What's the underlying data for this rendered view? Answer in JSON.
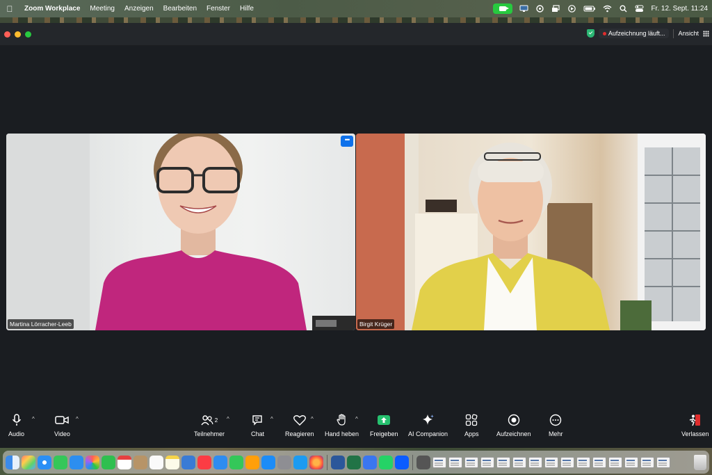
{
  "menubar": {
    "app_name": "Zoom Workplace",
    "menus": [
      "Meeting",
      "Anzeigen",
      "Bearbeiten",
      "Fenster",
      "Hilfe"
    ],
    "status_icons": [
      "zoom-video-icon",
      "display-icon",
      "vpn-icon",
      "screen-mirror-icon",
      "play-icon",
      "battery-icon",
      "wifi-icon",
      "search-icon",
      "control-center-icon"
    ],
    "clock": "Fr. 12. Sept.  11:24"
  },
  "titlebar": {
    "recording_label": "Aufzeichnung läuft...",
    "view_label": "Ansicht"
  },
  "participants": [
    {
      "name": "Martina Lörracher-Leeb"
    },
    {
      "name": "Birgit Krüger"
    }
  ],
  "toolbar": {
    "audio": "Audio",
    "video": "Video",
    "participants": "Teilnehmer",
    "participant_count": "2",
    "chat": "Chat",
    "react": "Reagieren",
    "raise_hand": "Hand heben",
    "share": "Freigeben",
    "ai_companion": "AI Companion",
    "apps": "Apps",
    "record": "Aufzeichnen",
    "more": "Mehr",
    "leave": "Verlassen"
  },
  "colors": {
    "accent_blue": "#0e71eb",
    "share_green": "#26c16f",
    "recording_red": "#e02d2d",
    "leave_red": "#e02d2d"
  }
}
